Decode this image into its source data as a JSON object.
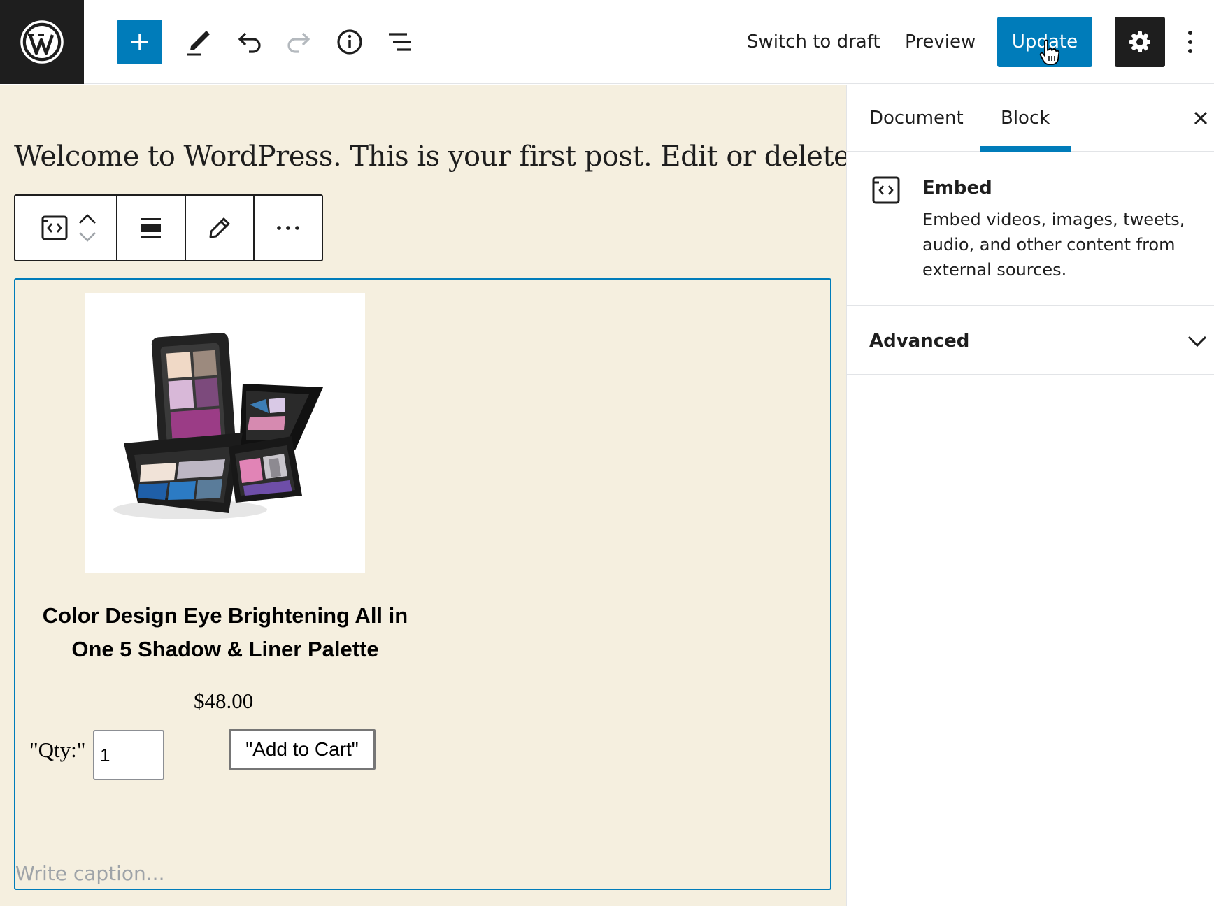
{
  "topbar": {
    "add_block_icon": "plus-icon",
    "tools_icon": "pencil-icon",
    "undo_icon": "undo-icon",
    "redo_icon": "redo-icon",
    "info_icon": "info-icon",
    "outline_icon": "list-view-icon",
    "switch_to_draft": "Switch to draft",
    "preview": "Preview",
    "update": "Update",
    "settings_icon": "gear-icon",
    "more_icon": "more-vertical-icon"
  },
  "editor": {
    "post_text": "Welcome to WordPress. This is your first post. Edit or delete it,",
    "block_toolbar": {
      "block_type_icon": "embed-icon",
      "move_up_icon": "chevron-up-icon",
      "move_down_icon": "chevron-down-icon",
      "align_icon": "align-center-icon",
      "edit_icon": "pencil-icon",
      "more_icon": "more-horizontal-icon"
    },
    "product": {
      "title": "Color Design Eye Brightening All in One 5 Shadow & Liner Palette",
      "price": "$48.00",
      "qty_label": "\"Qty:\"",
      "qty_value": "1",
      "add_to_cart": "\"Add to Cart\""
    },
    "caption_placeholder": "Write caption..."
  },
  "sidebar": {
    "tabs": [
      {
        "label": "Document",
        "active": false
      },
      {
        "label": "Block",
        "active": true
      }
    ],
    "close_icon": "close-icon",
    "block_card": {
      "icon": "embed-icon",
      "title": "Embed",
      "description": "Embed videos, images, tweets, audio, and other content from external sources."
    },
    "advanced_panel": {
      "title": "Advanced",
      "expanded": false
    }
  },
  "colors": {
    "accent": "#007cba",
    "dark": "#1e1e1e",
    "canvas_bg": "#f5efdf"
  }
}
